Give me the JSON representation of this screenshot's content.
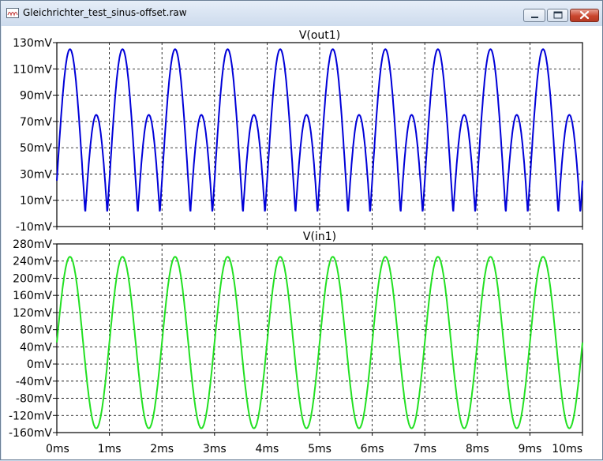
{
  "window": {
    "title": "Gleichrichter_test_sinus-offset.raw"
  },
  "icons": {
    "app": "waveform-app-icon",
    "minimize": "minimize-icon",
    "maximize": "maximize-icon",
    "close": "close-icon"
  },
  "colors": {
    "out1": "#0000d8",
    "in1": "#22e022",
    "grid": "#000000",
    "background": "#ffffff"
  },
  "chart_data": [
    {
      "type": "line",
      "title": "V(out1)",
      "x_unit": "ms",
      "y_unit": "mV",
      "xlim": [
        0,
        10
      ],
      "ylim": [
        -10,
        130
      ],
      "y_ticks": [
        "130mV",
        "110mV",
        "90mV",
        "70mV",
        "50mV",
        "30mV",
        "10mV",
        "-10mV"
      ],
      "x_ticks": [
        "0ms",
        "1ms",
        "2ms",
        "3ms",
        "4ms",
        "5ms",
        "6ms",
        "7ms",
        "8ms",
        "9ms",
        "10ms"
      ],
      "grid": true,
      "series": [
        {
          "name": "V(out1)",
          "x": [
            0,
            0.25,
            0.5,
            0.625,
            0.75,
            1.0,
            1.25,
            1.5,
            1.625,
            1.75,
            2.0,
            2.25,
            2.5,
            2.625,
            2.75,
            3.0,
            3.25,
            3.5,
            3.625,
            3.75,
            4.0,
            4.25,
            4.5,
            4.625,
            4.75,
            5.0,
            5.25,
            5.5,
            5.625,
            5.75,
            6.0,
            6.25,
            6.5,
            6.625,
            6.75,
            7.0,
            7.25,
            7.5,
            7.625,
            7.75,
            8.0,
            8.25,
            8.5,
            8.625,
            8.75,
            9.0,
            9.25,
            9.5,
            9.625,
            9.75,
            10.0
          ],
          "values": [
            25,
            125,
            25,
            0,
            75,
            25,
            125,
            25,
            0,
            75,
            25,
            125,
            25,
            0,
            75,
            25,
            125,
            25,
            0,
            75,
            25,
            125,
            25,
            0,
            75,
            25,
            125,
            25,
            0,
            75,
            25,
            125,
            25,
            0,
            75,
            25,
            125,
            25,
            0,
            75,
            25,
            125,
            25,
            0,
            75,
            25,
            125,
            25,
            0,
            75,
            0
          ]
        }
      ]
    },
    {
      "type": "line",
      "title": "V(in1)",
      "x_unit": "ms",
      "y_unit": "mV",
      "xlim": [
        0,
        10
      ],
      "ylim": [
        -160,
        280
      ],
      "y_ticks": [
        "280mV",
        "240mV",
        "200mV",
        "160mV",
        "120mV",
        "80mV",
        "40mV",
        "0mV",
        "-40mV",
        "-80mV",
        "-120mV",
        "-160mV"
      ],
      "x_ticks": [
        "0ms",
        "1ms",
        "2ms",
        "3ms",
        "4ms",
        "5ms",
        "6ms",
        "7ms",
        "8ms",
        "9ms",
        "10ms"
      ],
      "grid": true,
      "series": [
        {
          "name": "V(in1)",
          "offset": 50,
          "amplitude": 200,
          "frequency_khz": 1,
          "x": [
            0,
            0.25,
            0.5,
            0.75,
            1.0,
            1.25,
            1.5,
            1.75,
            2.0,
            2.25,
            2.5,
            2.75,
            3.0,
            3.25,
            3.5,
            3.75,
            4.0,
            4.25,
            4.5,
            4.75,
            5.0,
            5.25,
            5.5,
            5.75,
            6.0,
            6.25,
            6.5,
            6.75,
            7.0,
            7.25,
            7.5,
            7.75,
            8.0,
            8.25,
            8.5,
            8.75,
            9.0,
            9.25,
            9.5,
            9.75,
            10.0
          ],
          "values": [
            50,
            250,
            50,
            -150,
            50,
            250,
            50,
            -150,
            50,
            250,
            50,
            -150,
            50,
            250,
            50,
            -150,
            50,
            250,
            50,
            -150,
            50,
            250,
            50,
            -150,
            50,
            250,
            50,
            -150,
            50,
            250,
            50,
            -150,
            50,
            250,
            50,
            -150,
            50,
            250,
            50,
            -150,
            50
          ]
        }
      ]
    }
  ]
}
